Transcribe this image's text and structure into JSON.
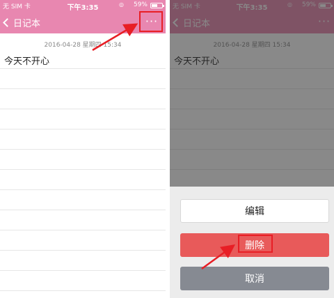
{
  "status_bar": {
    "carrier": "无 SIM 卡",
    "time": "下午3:35",
    "battery_percent_text": "59%",
    "battery_level": 0.59
  },
  "nav": {
    "back_label": "日记本",
    "more_label": "···"
  },
  "note": {
    "date": "2016-04-28 星期四 15:34",
    "text": "今天不开心"
  },
  "action_sheet": {
    "edit": "编辑",
    "delete": "删除",
    "cancel": "取消"
  },
  "colors": {
    "header": "#e887b0",
    "delete_button": "#e85a5a",
    "cancel_button": "#868a92",
    "highlight": "#e81e25"
  }
}
